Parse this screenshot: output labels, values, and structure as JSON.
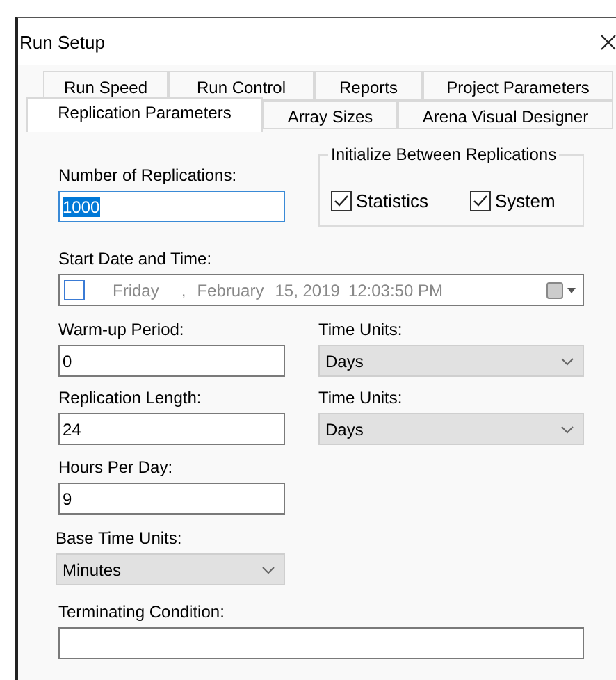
{
  "window": {
    "title": "Run Setup"
  },
  "tab_rows": [
    [
      {
        "label": "Run Speed",
        "selected": false
      },
      {
        "label": "Run Control",
        "selected": false
      },
      {
        "label": "Reports",
        "selected": false
      },
      {
        "label": "Project Parameters",
        "selected": false
      }
    ],
    [
      {
        "label": "Replication Parameters",
        "selected": true
      },
      {
        "label": "Array Sizes",
        "selected": false
      },
      {
        "label": "Arena Visual Designer",
        "selected": false
      }
    ]
  ],
  "number_of_replications": {
    "label": "Number of Replications:",
    "value": "1000",
    "text_selected": true,
    "focused": true
  },
  "initialize_group": {
    "title": "Initialize Between Replications",
    "options": [
      {
        "label": "Statistics",
        "checked": true
      },
      {
        "label": "System",
        "checked": true
      }
    ]
  },
  "start_date": {
    "label": "Start Date and Time:",
    "checked": false,
    "weekday": "Friday",
    "comma": ",",
    "month": "February",
    "day_year": "15, 2019",
    "time": "12:03:50 PM"
  },
  "period_rows": [
    {
      "label": "Warm-up Period:",
      "value": "0",
      "units_label": "Time Units:",
      "units": "Days"
    },
    {
      "label": "Replication Length:",
      "value": "24",
      "units_label": "Time Units:",
      "units": "Days"
    }
  ],
  "hours_per_day": {
    "label": "Hours Per Day:",
    "value": "9"
  },
  "base_time_units": {
    "label": "Base Time Units:",
    "value": "Minutes"
  },
  "terminating_condition": {
    "label": "Terminating Condition:"
  }
}
